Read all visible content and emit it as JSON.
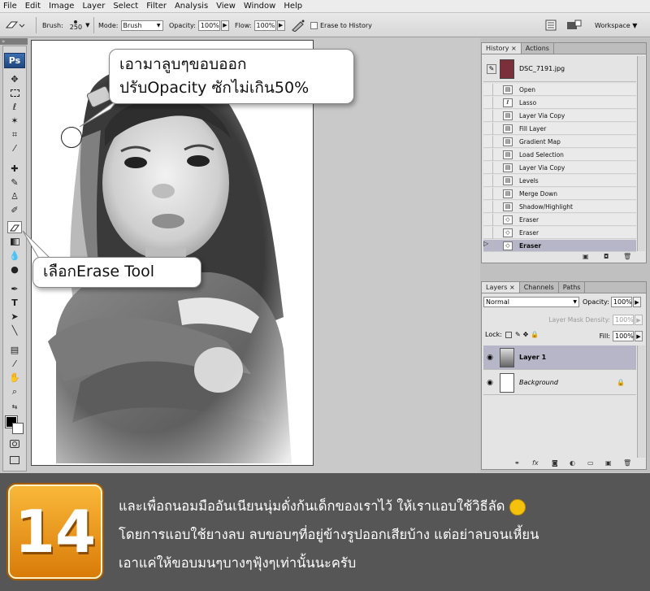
{
  "menu": [
    "File",
    "Edit",
    "Image",
    "Layer",
    "Select",
    "Filter",
    "Analysis",
    "View",
    "Window",
    "Help"
  ],
  "options": {
    "brush_label": "Brush:",
    "brush_size": "250",
    "mode_label": "Mode:",
    "mode_value": "Brush",
    "opacity_label": "Opacity:",
    "opacity_value": "100%",
    "flow_label": "Flow:",
    "flow_value": "100%",
    "erase_history_label": "Erase to History",
    "workspace_label": "Workspace ▼"
  },
  "tools": {
    "ps_logo": "Ps"
  },
  "annotations": {
    "bubble_top_line1": "เอามาลูบๆขอบออก",
    "bubble_top_line2": "ปรับOpacity ซักไม่เกิน50%",
    "bubble_tool": "เลือกErase Tool"
  },
  "history_panel": {
    "tabs": [
      "History ×",
      "Actions"
    ],
    "snapshot_name": "DSC_7191.jpg",
    "steps": [
      "Open",
      "Lasso",
      "Layer Via Copy",
      "Fill Layer",
      "Gradient Map",
      "Load Selection",
      "Layer Via Copy",
      "Levels",
      "Merge Down",
      "Shadow/Highlight",
      "Eraser",
      "Eraser",
      "Eraser"
    ],
    "selected_step_index": 12
  },
  "layers_panel": {
    "tabs": [
      "Layers ×",
      "Channels",
      "Paths"
    ],
    "blend_mode": "Normal",
    "opacity_label": "Opacity:",
    "opacity_value": "100%",
    "mask_density_label": "Layer Mask Density:",
    "mask_density_value": "100%",
    "lock_label": "Lock:",
    "fill_label": "Fill:",
    "fill_value": "100%",
    "layers": [
      {
        "name": "Layer 1",
        "selected": true
      },
      {
        "name": "Background",
        "selected": false,
        "locked": true
      }
    ]
  },
  "banner": {
    "step_number": "14",
    "line1": "และเพื่อถนอมมืออันเนียนนุ่มดั่งก้นเด็กของเราไว้ ให้เราแอบใช้วิธีลัด",
    "line2": "โดยการแอบใช้ยางลบ ลบขอบๆที่อยู่ข้างรูปออกเสียบ้าง แต่อย่าลบจนเหี้ยน",
    "line3": "เอาแค่ให้ขอบมนๆบางๆฟุ้งๆเท่านั้นนะครับ"
  },
  "colors": {
    "banner_bg": "#565656",
    "badge_orange": "#f0a020",
    "selection_row": "#b6b6c8"
  }
}
